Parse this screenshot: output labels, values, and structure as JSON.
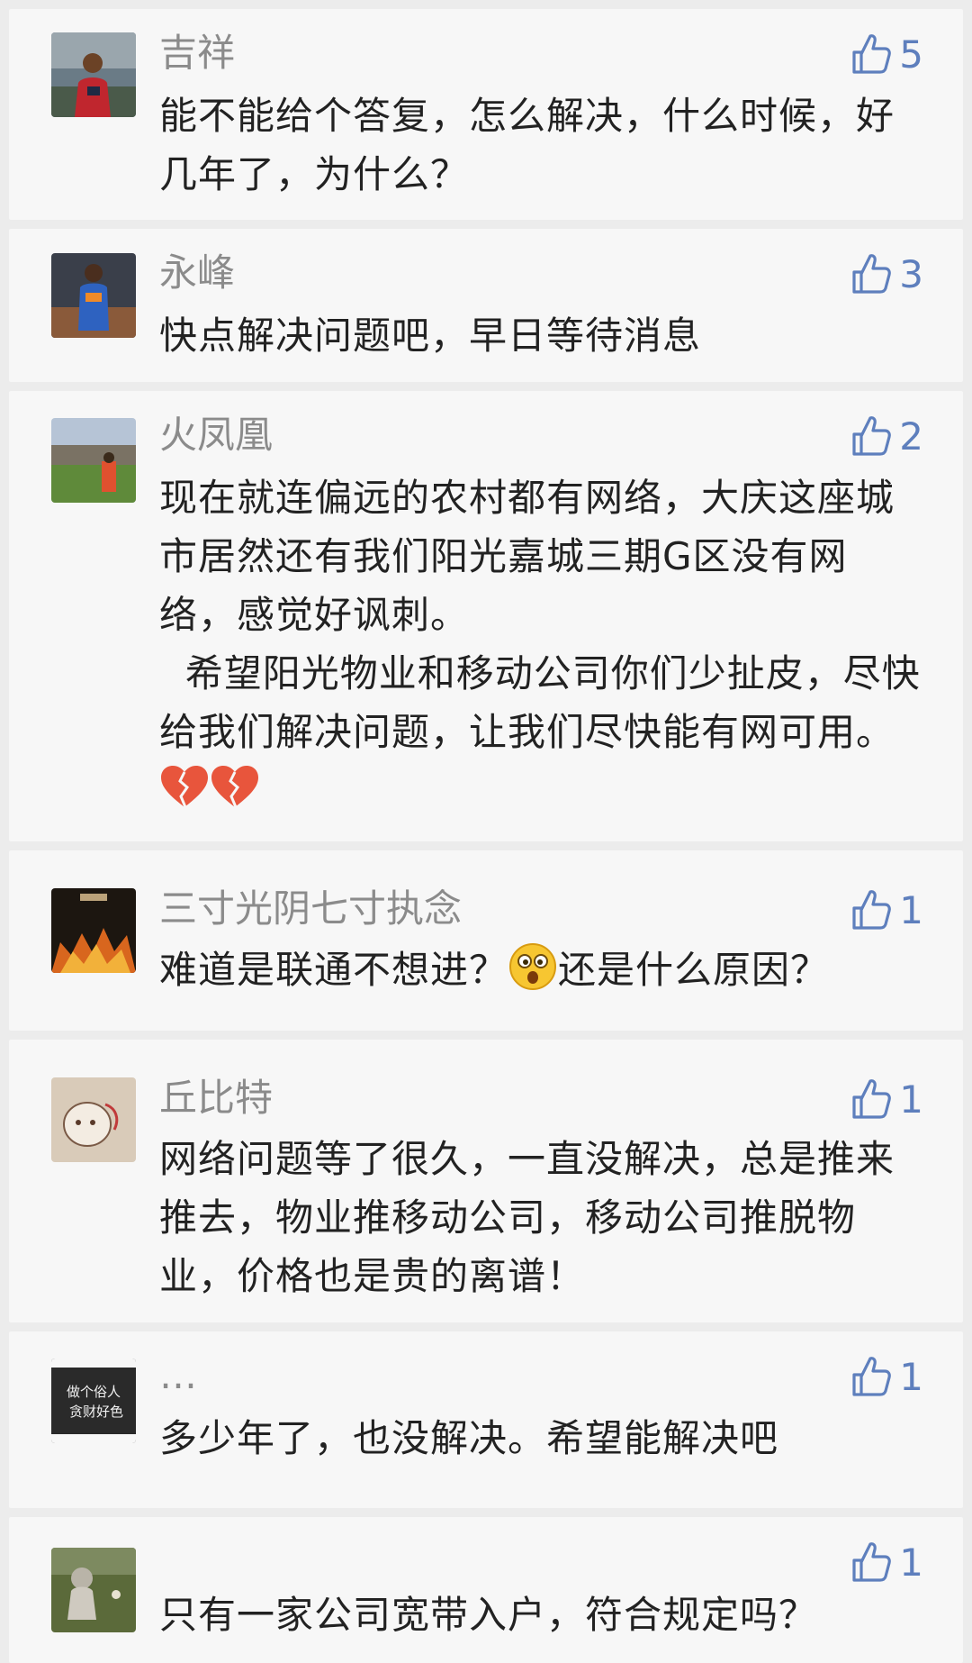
{
  "comments": [
    {
      "name": "吉祥",
      "likes": "5",
      "avatar": "avatar-basketball-player",
      "text": "能不能给个答复，怎么解决，什么时候，好几年了，为什么？"
    },
    {
      "name": "永峰",
      "likes": "3",
      "avatar": "avatar-okc-player",
      "text": "快点解决问题吧，早日等待消息"
    },
    {
      "name": "火凤凰",
      "likes": "2",
      "avatar": "avatar-landscape-person",
      "text_p1": "现在就连偏远的农村都有网络，大庆这座城市居然还有我们阳光嘉城三期G区没有网络，感觉好讽刺。",
      "text_p2": "  希望阳光物业和移动公司你们少扯皮，尽快给我们解决问题，让我们尽快能有网可用。",
      "emoji": [
        "broken-heart",
        "broken-heart"
      ]
    },
    {
      "name": "三寸光阴七寸执念",
      "likes": "1",
      "avatar": "avatar-fire-poster",
      "text_a": "难道是联通不想进？",
      "text_b": "还是什么原因？",
      "emoji": [
        "surprised-face"
      ]
    },
    {
      "name": "丘比特",
      "likes": "1",
      "avatar": "avatar-sketch",
      "text": "网络问题等了很久，一直没解决，总是推来推去，物业推移动公司，移动公司推脱物业，价格也是贵的离谱！"
    },
    {
      "name": "…",
      "likes": "1",
      "avatar": "avatar-text-card",
      "avatar_text": "做个俗人\n贪财好色",
      "text": "多少年了，也没解决。希望能解决吧"
    },
    {
      "name": "",
      "likes": "1",
      "avatar": "avatar-child-grass",
      "text": "只有一家公司宽带入户，符合规定吗？"
    }
  ],
  "colors": {
    "background": "#ececec",
    "card": "#f7f7f7",
    "name": "#8b8b8b",
    "text": "#222222",
    "like": "#5e7fbd"
  },
  "icons": {
    "like": "thumbs-up-icon"
  }
}
